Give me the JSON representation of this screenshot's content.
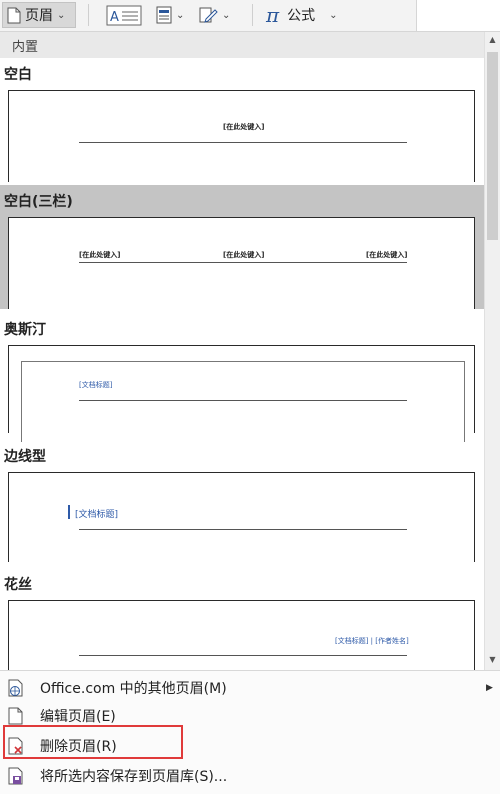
{
  "ribbon": {
    "header_button_label": "页眉",
    "equation_label": "公式",
    "equation_symbol": "π"
  },
  "gallery": {
    "category": "内置",
    "items": [
      {
        "title": "空白",
        "placeholders": [
          "[在此处键入]"
        ]
      },
      {
        "title": "空白(三栏)",
        "placeholders": [
          "[在此处键入]",
          "[在此处键入]",
          "[在此处键入]"
        ],
        "selected": true
      },
      {
        "title": "奥斯汀",
        "placeholders": [
          "[文档标题]"
        ]
      },
      {
        "title": "边线型",
        "placeholders": [
          "[文档标题]"
        ]
      },
      {
        "title": "花丝",
        "placeholders": [
          "[文档标题] | [作者姓名]"
        ]
      }
    ]
  },
  "menu": {
    "items": [
      {
        "label": "Office.com 中的其他页眉(M)",
        "has_submenu": true,
        "icon": "globe-page-icon"
      },
      {
        "label": "编辑页眉(E)",
        "icon": "edit-header-icon"
      },
      {
        "label": "删除页眉(R)",
        "icon": "delete-header-icon",
        "highlighted": true
      },
      {
        "label": "将所选内容保存到页眉库(S)...",
        "icon": "save-gallery-icon"
      }
    ]
  },
  "colors": {
    "highlight": "#e03a3a",
    "accent": "#2b579a",
    "placeholder_blue": "#2e5aa8"
  }
}
